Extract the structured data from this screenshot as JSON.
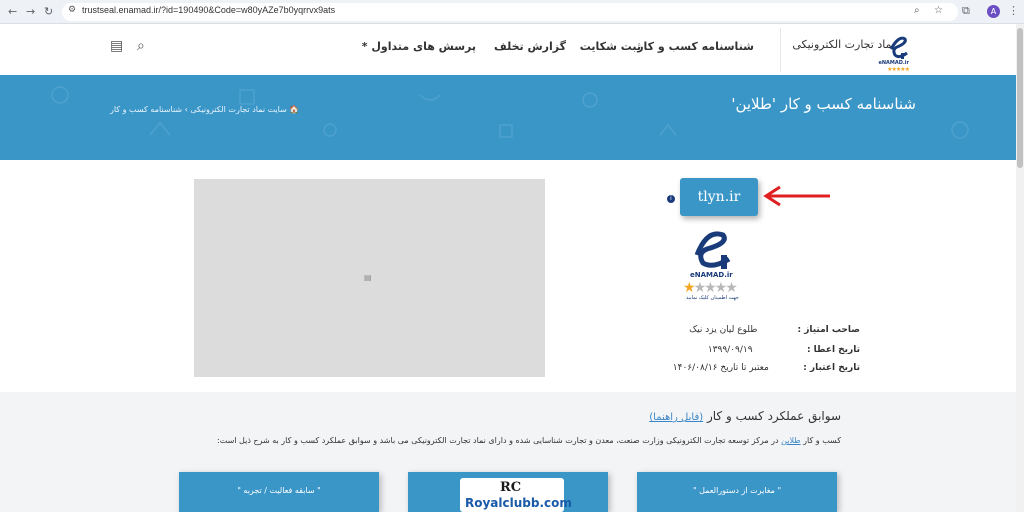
{
  "browser": {
    "url": "trustseal.enamad.ir/?id=190490&Code=w80yAZe7b0yqrrvx9ats",
    "profile_initial": "A",
    "back_icon": "arrow-left-icon",
    "forward_icon": "arrow-right-icon",
    "reload_icon": "reload-icon"
  },
  "header": {
    "logo_text": "نماد تجارت الکترونیکی",
    "logo_sub": "eNAMAD.ir",
    "logo_stars": "★★★★★",
    "nav": [
      "شناسنامه کسب و کار",
      "ثبت شکایت",
      "گزارش تخلف",
      "پرسش های متداول *"
    ]
  },
  "banner": {
    "title": "شناسنامه کسب و کار 'طلاین'",
    "breadcrumb_home": "🏠 سایت نماد تجارت الکترونیکی",
    "breadcrumb_sep": "›",
    "breadcrumb_current": "شناسنامه کسب و کار"
  },
  "seal": {
    "domain": "tlyn.ir",
    "name": "eNAMAD.ir",
    "stars_on": "★",
    "stars_off": "★★★★",
    "star_rating": 1,
    "star_max": 5,
    "tagline": "جهت اطمینان کلیک نمایید",
    "info_icon": "i"
  },
  "details": [
    {
      "label": "صاحب امتیاز :",
      "value": "طلوع لیان یزد نیک"
    },
    {
      "label": "تاریخ اعطا :",
      "value": "۱۳۹۹/۰۹/۱۹"
    },
    {
      "label": "تاریخ اعتبار :",
      "value": "معتبر تا تاریخ ۱۴۰۶/۰۸/۱۶"
    }
  ],
  "history": {
    "title": "سوابق عملکرد کسب و کار",
    "guide_link": "(فایل راهنما)",
    "desc_prefix": "کسب و کار",
    "desc_link": "طلاین",
    "desc_rest": "در مرکز توسعه تجارت الکترونیکی وزارت صنعت، معدن و تجارت شناسایی شده و دارای نماد تجارت الکترونیکی می باشد و سوابق عملکرد کسب و کار به شرح ذیل است:",
    "cards": [
      "\" مغایرت از دستورالعمل \"",
      "\" \"",
      "\" سابقه فعالیت / تجربه \""
    ]
  },
  "watermark": {
    "mark": "RC",
    "text": "Royalclubb.com"
  },
  "colors": {
    "banner": "#3b96c8",
    "accent_link": "#3b86c8",
    "seal_navy": "#1a3b7a",
    "arrow": "#e02020",
    "star": "#f5a623"
  }
}
